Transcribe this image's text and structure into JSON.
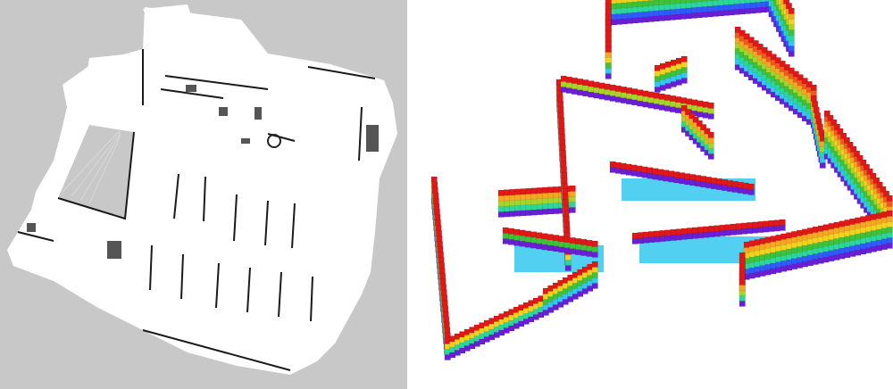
{
  "figure": {
    "panels": [
      {
        "kind": "2d-occupancy-grid",
        "colors": {
          "unknown": "#c8c8c8",
          "free": "#ffffff",
          "occupied": "#111111"
        }
      },
      {
        "kind": "3d-octomap-voxels",
        "color_by": "height",
        "colormap": [
          "#6a1fd6",
          "#2f5cff",
          "#33c8f0",
          "#2dd69a",
          "#3fc23a",
          "#a8d42a",
          "#f2d21f",
          "#f5a623",
          "#f05a1f",
          "#e01818"
        ]
      }
    ]
  }
}
